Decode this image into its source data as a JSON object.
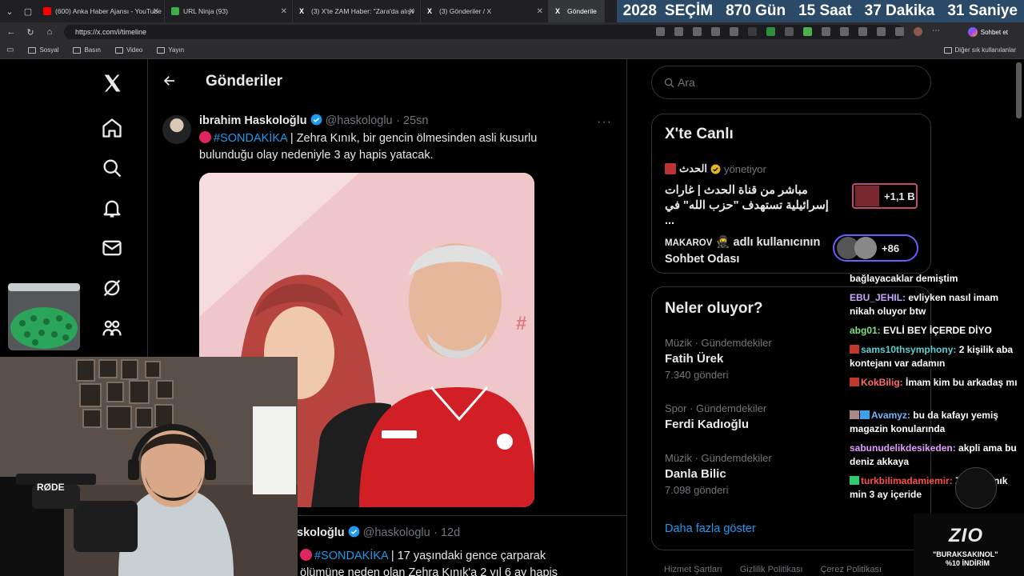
{
  "browser": {
    "tabs": [
      {
        "label": "(600) Anka Haber Ajansı - YouTube",
        "fav": "#ff0000"
      },
      {
        "label": "URL Ninja (93)",
        "fav": "#3fae49"
      },
      {
        "label": "(3) X'te ZAM Haber: \"Zara'da alışv",
        "fav": "#000000"
      },
      {
        "label": "(3) Gönderiler / X",
        "fav": "#000000"
      },
      {
        "label": "Gönderile",
        "fav": "#000000"
      }
    ],
    "url": "https://x.com/i/timeline",
    "chat_button": "Sohbet et",
    "bookmarks": [
      "Sosyal",
      "Basın",
      "Video",
      "Yayın"
    ],
    "other_bookmarks": "Diğer sık kullanılanlar"
  },
  "countdown": [
    "2028",
    "SEÇİM",
    "870 Gün",
    "15 Saat",
    "37 Dakika",
    "31 Saniye"
  ],
  "header": {
    "title": "Gönderiler"
  },
  "tweet1": {
    "name": "ibrahim Haskoloğlu",
    "handle": "@haskologlu",
    "time": "· 25sn",
    "hashtag": "#SONDAKİKA",
    "text": " | Zehra Kınık, bir gencin ölmesinden asli kusurlu bulunduğu olay nedeniyle 3 ay hapis yatacak."
  },
  "tweet2": {
    "name": "skoloğlu",
    "handle": "@haskologlu",
    "time": "· 12d",
    "hashtag": "#SONDAKİKA",
    "text": " | 17 yaşındaki gence çarparak",
    "text2": "ölümüne neden olan Zehra Kınık'a 2 yıl 6 ay hapis"
  },
  "search": {
    "placeholder": "Ara"
  },
  "live": {
    "title": "X'te Canlı",
    "host": "الحدث",
    "host_suffix": "yönetiyor",
    "space_title": "مباشر من قناة الحدث | غارات إسرائيلية تستهدف \"حزب الله\" في ...",
    "space_count": "+1,1 B",
    "room_user": "MAKAROV",
    "room_text": "adlı kullanıcının Sohbet Odası",
    "room_count": "+86"
  },
  "trends": {
    "title": "Neler oluyor?",
    "items": [
      {
        "meta": "Müzik · Gündemdekiler",
        "name": "Fatih Ürek",
        "count": "7.340 gönderi"
      },
      {
        "meta": "Spor · Gündemdekiler",
        "name": "Ferdi Kadıoğlu",
        "count": ""
      },
      {
        "meta": "Müzik · Gündemdekiler",
        "name": "Danla Bilic",
        "count": "7.098 gönderi"
      }
    ],
    "more": "Daha fazla göster"
  },
  "footer": [
    "Hizmet Şartları",
    "Gizlilik Politikası",
    "Çerez Politikası"
  ],
  "chat": [
    {
      "user": "",
      "ucolor": "#ffffff",
      "text": "bağlayacaklar demiştim"
    },
    {
      "user": "EBU_JEHIL:",
      "ucolor": "#c9a6ff",
      "text": " evliyken nasıl imam nikah oluyor btw"
    },
    {
      "user": "abg01:",
      "ucolor": "#7ee27e",
      "text": " EVLİ BEY İÇERDE DİYO"
    },
    {
      "user": "sams10thsymphony:",
      "ucolor": "#5ad1d1",
      "text": " 2 kişilik aba kontejanı var adamın"
    },
    {
      "user": "KokBilig:",
      "ucolor": "#ff6b6b",
      "text": " İmam kim bu arkadaş mı"
    },
    {
      "user": "Avamyz:",
      "ucolor": "#6fb6ff",
      "text": " bu da kafayı yemiş magazin konularında"
    },
    {
      "user": "sabunudelikdesikeden:",
      "ucolor": "#e69cff",
      "text": " akpli ama bu deniz akkaya"
    },
    {
      "user": "turkbilimadamiemir:",
      "ucolor": "#ff4d4d",
      "text": " Zehra Kınık min 3 ay içeride"
    }
  ],
  "promo": {
    "brand": "ZIO",
    "line1": "\"BURAKSAKINOL\"",
    "line2": "%10 İNDİRİM"
  },
  "webcam": {
    "mic_brand": "RØDE"
  }
}
